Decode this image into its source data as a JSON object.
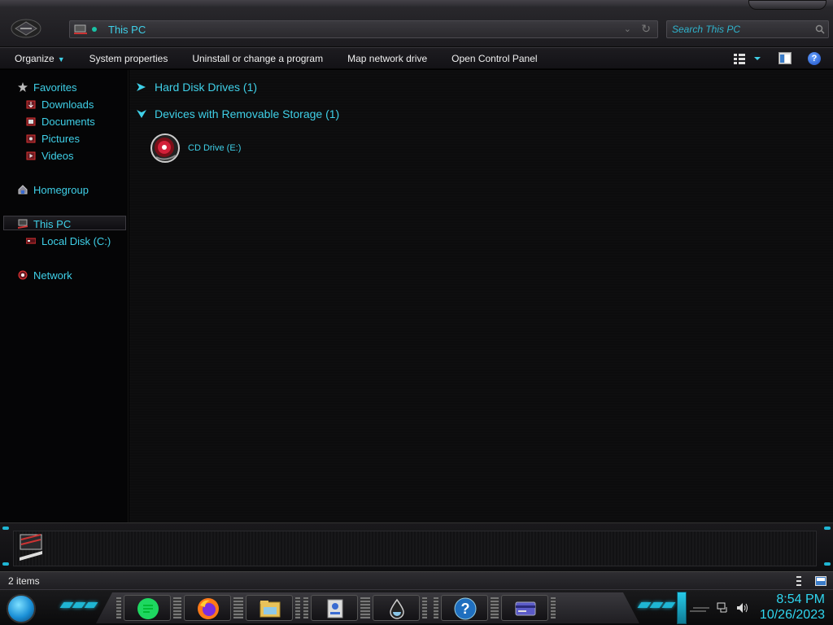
{
  "window": {
    "address": "This PC",
    "search_placeholder": "Search This PC"
  },
  "toolbar": {
    "organize": "Organize",
    "system_properties": "System properties",
    "uninstall": "Uninstall or change a program",
    "map_drive": "Map network drive",
    "control_panel": "Open Control Panel"
  },
  "nav": {
    "favorites": "Favorites",
    "downloads": "Downloads",
    "documents": "Documents",
    "pictures": "Pictures",
    "videos": "Videos",
    "homegroup": "Homegroup",
    "this_pc": "This PC",
    "local_disk": "Local Disk (C:)",
    "network": "Network"
  },
  "content": {
    "group_hdd": "Hard Disk Drives (1)",
    "group_removable": "Devices with Removable Storage (1)",
    "cd_drive": "CD Drive (E:)"
  },
  "status": {
    "items": "2 items"
  },
  "clock": {
    "time": "8:54 PM",
    "date": "10/26/2023"
  },
  "colors": {
    "accent": "#3fd0e8",
    "background": "#000000"
  },
  "icons": [
    "nav-back-icon",
    "this-pc-icon",
    "search-icon",
    "help-icon",
    "star-icon",
    "folder-icon",
    "homegroup-icon",
    "computer-icon",
    "disk-icon",
    "network-icon",
    "chevron-right-icon",
    "chevron-down-icon",
    "cd-drive-icon",
    "start-orb-icon",
    "notes-app-icon",
    "firefox-icon",
    "file-explorer-icon",
    "user-app-icon",
    "water-drop-icon",
    "help-app-icon",
    "card-app-icon",
    "network-tray-icon",
    "volume-icon"
  ]
}
